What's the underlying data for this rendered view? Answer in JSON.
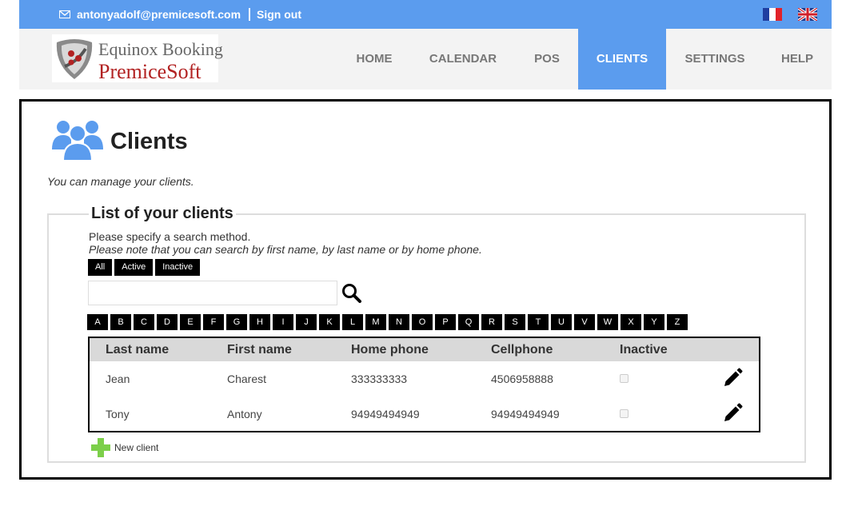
{
  "topbar": {
    "email": "antonyadolf@premicesoft.com",
    "signout": "Sign out",
    "accent": "#5b9cee"
  },
  "logo": {
    "line1": "Equinox Booking",
    "line2": "PremiceSoft"
  },
  "nav": {
    "items": [
      "HOME",
      "CALENDAR",
      "POS",
      "CLIENTS",
      "SETTINGS",
      "HELP"
    ],
    "active": "CLIENTS"
  },
  "page": {
    "title": "Clients",
    "description": "You can manage your clients."
  },
  "clients_box": {
    "legend": "List of your clients",
    "hint1": "Please specify a search method.",
    "hint2": "Please note that you can search by first name, by last name or by home phone.",
    "filters": [
      "All",
      "Active",
      "Inactive"
    ],
    "search_placeholder": "",
    "letters": [
      "A",
      "B",
      "C",
      "D",
      "E",
      "F",
      "G",
      "H",
      "I",
      "J",
      "K",
      "L",
      "M",
      "N",
      "O",
      "P",
      "Q",
      "R",
      "S",
      "T",
      "U",
      "V",
      "W",
      "X",
      "Y",
      "Z"
    ]
  },
  "table": {
    "headers": [
      "Last name",
      "First name",
      "Home phone",
      "Cellphone",
      "Inactive"
    ],
    "rows": [
      {
        "last": "Jean",
        "first": "Charest",
        "home": "333333333",
        "cell": "4506958888",
        "inactive": false
      },
      {
        "last": "Tony",
        "first": "Antony",
        "home": "94949494949",
        "cell": "94949494949",
        "inactive": false
      }
    ]
  },
  "new_client": "New client",
  "icons": {
    "email": "envelope-icon",
    "search": "search-icon",
    "edit": "pencil-icon",
    "add": "plus-icon",
    "users": "users-icon"
  }
}
